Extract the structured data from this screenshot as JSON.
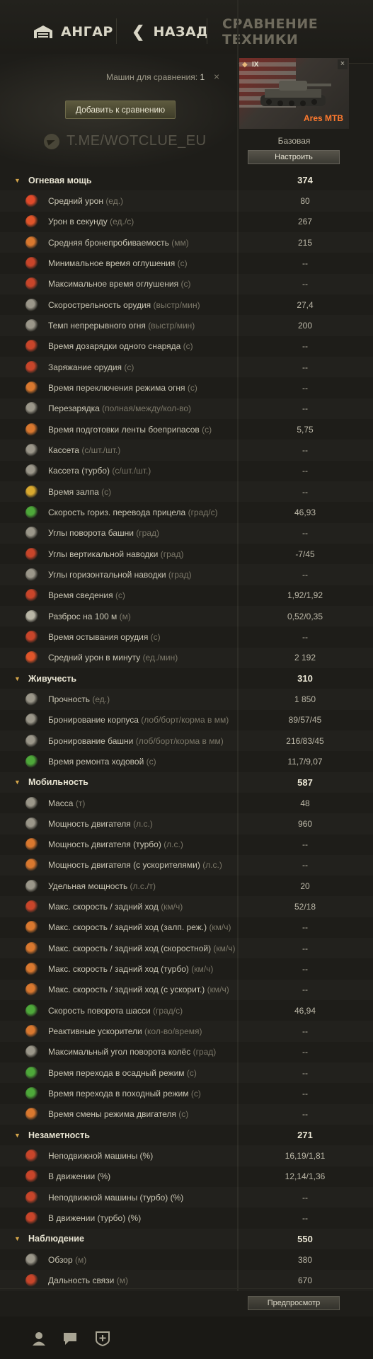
{
  "nav": {
    "hangar_label": "АНГАР",
    "back_label": "НАЗАД",
    "title": "СРАВНЕНИЕ ТЕХНИКИ"
  },
  "compare": {
    "machines_label": "Машин для сравнения:",
    "machines_count": "1",
    "clear_symbol": "×",
    "add_button": "Добавить к сравнению",
    "watermark": "T.ME/WOTCLUE_EU"
  },
  "tank": {
    "tier": "IX",
    "name": "Ares MTB",
    "config": "Базовая",
    "configure_button": "Настроить",
    "close_symbol": "×"
  },
  "rows": [
    {
      "kind": "section",
      "label": "Огневая мощь",
      "value": "374"
    },
    {
      "kind": "stat",
      "label": "Средний урон",
      "unit": "(ед.)",
      "value": "80",
      "icon": "shell-icon",
      "color": "#e04a2a"
    },
    {
      "kind": "stat",
      "label": "Урон в секунду",
      "unit": "(ед./с)",
      "value": "267",
      "icon": "dps-icon",
      "color": "#e0552a"
    },
    {
      "kind": "stat",
      "label": "Средняя бронепробиваемость",
      "unit": "(мм)",
      "value": "215",
      "icon": "penetration-icon",
      "color": "#d9782f"
    },
    {
      "kind": "stat",
      "label": "Минимальное время оглушения",
      "unit": "(с)",
      "value": "--",
      "icon": "stun-min-icon",
      "color": "#c8452a"
    },
    {
      "kind": "stat",
      "label": "Максимальное время оглушения",
      "unit": "(с)",
      "value": "--",
      "icon": "stun-max-icon",
      "color": "#c8452a"
    },
    {
      "kind": "stat",
      "label": "Скорострельность орудия",
      "unit": "(выстр/мин)",
      "value": "27,4",
      "icon": "rate-of-fire-icon",
      "color": "#9b978a"
    },
    {
      "kind": "stat",
      "label": "Темп непрерывного огня",
      "unit": "(выстр/мин)",
      "value": "200",
      "icon": "continuous-fire-icon",
      "color": "#9b978a"
    },
    {
      "kind": "stat",
      "label": "Время дозарядки одного снаряда",
      "unit": "(с)",
      "value": "--",
      "icon": "shell-reload-icon",
      "color": "#c8452a"
    },
    {
      "kind": "stat",
      "label": "Заряжание орудия",
      "unit": "(с)",
      "value": "--",
      "icon": "gun-charge-icon",
      "color": "#c8452a"
    },
    {
      "kind": "stat",
      "label": "Время переключения режима огня",
      "unit": "(с)",
      "value": "--",
      "icon": "fire-mode-icon",
      "color": "#d9782f"
    },
    {
      "kind": "stat",
      "label": "Перезарядка",
      "unit": "(полная/между/кол-во)",
      "value": "--",
      "icon": "reload-icon",
      "color": "#9b978a"
    },
    {
      "kind": "stat",
      "label": "Время подготовки ленты боеприпасов",
      "unit": "(с)",
      "value": "5,75",
      "icon": "ammo-belt-icon",
      "color": "#d9782f"
    },
    {
      "kind": "stat",
      "label": "Кассета",
      "unit": "(с/шт./шт.)",
      "value": "--",
      "icon": "clip-icon",
      "color": "#9b978a"
    },
    {
      "kind": "stat",
      "label": "Кассета (турбо)",
      "unit": "(с/шт./шт.)",
      "value": "--",
      "icon": "clip-turbo-icon",
      "color": "#9b978a"
    },
    {
      "kind": "stat",
      "label": "Время залпа",
      "unit": "(с)",
      "value": "--",
      "icon": "salvo-icon",
      "color": "#d9a92f"
    },
    {
      "kind": "stat",
      "label": "Скорость гориз. перевода прицела",
      "unit": "(град/с)",
      "value": "46,93",
      "icon": "traverse-icon",
      "color": "#4ea83a"
    },
    {
      "kind": "stat",
      "label": "Углы поворота башни",
      "unit": "(град)",
      "value": "--",
      "icon": "turret-angle-icon",
      "color": "#9b978a"
    },
    {
      "kind": "stat",
      "label": "Углы вертикальной наводки",
      "unit": "(град)",
      "value": "-7/45",
      "icon": "elevation-icon",
      "color": "#c8452a"
    },
    {
      "kind": "stat",
      "label": "Углы горизонтальной наводки",
      "unit": "(град)",
      "value": "--",
      "icon": "horizontal-aim-icon",
      "color": "#9b978a"
    },
    {
      "kind": "stat",
      "label": "Время сведения",
      "unit": "(с)",
      "value": "1,92/1,92",
      "icon": "aim-time-icon",
      "color": "#c8452a"
    },
    {
      "kind": "stat",
      "label": "Разброс на 100 м",
      "unit": "(м)",
      "value": "0,52/0,35",
      "icon": "dispersion-icon",
      "color": "#b9b6a6"
    },
    {
      "kind": "stat",
      "label": "Время остывания орудия",
      "unit": "(с)",
      "value": "--",
      "icon": "cooling-icon",
      "color": "#c8452a"
    },
    {
      "kind": "stat",
      "label": "Средний урон в минуту",
      "unit": "(ед./мин)",
      "value": "2 192",
      "icon": "dpm-icon",
      "color": "#e0552a"
    },
    {
      "kind": "section",
      "label": "Живучесть",
      "value": "310"
    },
    {
      "kind": "stat",
      "label": "Прочность",
      "unit": "(ед.)",
      "value": "1 850",
      "icon": "hit-points-icon",
      "color": "#9b978a"
    },
    {
      "kind": "stat",
      "label": "Бронирование корпуса",
      "unit": "(лоб/борт/корма в мм)",
      "value": "89/57/45",
      "icon": "hull-armor-icon",
      "color": "#9b978a"
    },
    {
      "kind": "stat",
      "label": "Бронирование башни",
      "unit": "(лоб/борт/корма в мм)",
      "value": "216/83/45",
      "icon": "turret-armor-icon",
      "color": "#9b978a"
    },
    {
      "kind": "stat",
      "label": "Время ремонта ходовой",
      "unit": "(с)",
      "value": "11,7/9,07",
      "icon": "track-repair-icon",
      "color": "#4ea83a"
    },
    {
      "kind": "section",
      "label": "Мобильность",
      "value": "587"
    },
    {
      "kind": "stat",
      "label": "Масса",
      "unit": "(т)",
      "value": "48",
      "icon": "weight-icon",
      "color": "#9b978a"
    },
    {
      "kind": "stat",
      "label": "Мощность двигателя",
      "unit": "(л.с.)",
      "value": "960",
      "icon": "engine-icon",
      "color": "#9b978a"
    },
    {
      "kind": "stat",
      "label": "Мощность двигателя (турбо)",
      "unit": "(л.с.)",
      "value": "--",
      "icon": "engine-turbo-icon",
      "color": "#d9782f"
    },
    {
      "kind": "stat",
      "label": "Мощность двигателя (с ускорителями)",
      "unit": "(л.с.)",
      "value": "--",
      "icon": "engine-boost-icon",
      "color": "#d9782f"
    },
    {
      "kind": "stat",
      "label": "Удельная мощность",
      "unit": "(л.с./т)",
      "value": "20",
      "icon": "power-ratio-icon",
      "color": "#9b978a"
    },
    {
      "kind": "stat",
      "label": "Макс. скорость / задний ход",
      "unit": "(км/ч)",
      "value": "52/18",
      "icon": "speed-icon",
      "color": "#c8452a"
    },
    {
      "kind": "stat",
      "label": "Макс. скорость / задний ход (залп. реж.)",
      "unit": "(км/ч)",
      "value": "--",
      "icon": "speed-salvo-icon",
      "color": "#d9782f"
    },
    {
      "kind": "stat",
      "label": "Макс. скорость / задний ход (скоростной)",
      "unit": "(км/ч)",
      "value": "--",
      "icon": "speed-fast-icon",
      "color": "#d9782f"
    },
    {
      "kind": "stat",
      "label": "Макс. скорость / задний ход (турбо)",
      "unit": "(км/ч)",
      "value": "--",
      "icon": "speed-turbo-icon",
      "color": "#d9782f"
    },
    {
      "kind": "stat",
      "label": "Макс. скорость / задний ход (с ускорит.)",
      "unit": "(км/ч)",
      "value": "--",
      "icon": "speed-boost-icon",
      "color": "#d9782f"
    },
    {
      "kind": "stat",
      "label": "Скорость поворота шасси",
      "unit": "(град/с)",
      "value": "46,94",
      "icon": "hull-traverse-icon",
      "color": "#4ea83a"
    },
    {
      "kind": "stat",
      "label": "Реактивные ускорители",
      "unit": "(кол-во/время)",
      "value": "--",
      "icon": "rocket-booster-icon",
      "color": "#d9782f"
    },
    {
      "kind": "stat",
      "label": "Максимальный угол поворота колёс",
      "unit": "(град)",
      "value": "--",
      "icon": "wheel-angle-icon",
      "color": "#9b978a"
    },
    {
      "kind": "stat",
      "label": "Время перехода в осадный режим",
      "unit": "(с)",
      "value": "--",
      "icon": "siege-mode-icon",
      "color": "#4ea83a"
    },
    {
      "kind": "stat",
      "label": "Время перехода в походный режим",
      "unit": "(с)",
      "value": "--",
      "icon": "travel-mode-icon",
      "color": "#4ea83a"
    },
    {
      "kind": "stat",
      "label": "Время смены режима двигателя",
      "unit": "(с)",
      "value": "--",
      "icon": "engine-mode-icon",
      "color": "#d9782f"
    },
    {
      "kind": "section",
      "label": "Незаметность",
      "value": "271"
    },
    {
      "kind": "stat",
      "label": "Неподвижной машины (%)",
      "unit": "",
      "value": "16,19/1,81",
      "icon": "camo-still-icon",
      "color": "#c8452a"
    },
    {
      "kind": "stat",
      "label": "В движении (%)",
      "unit": "",
      "value": "12,14/1,36",
      "icon": "camo-moving-icon",
      "color": "#c8452a"
    },
    {
      "kind": "stat",
      "label": "Неподвижной машины (турбо) (%)",
      "unit": "",
      "value": "--",
      "icon": "camo-still-turbo-icon",
      "color": "#c8452a"
    },
    {
      "kind": "stat",
      "label": "В движении (турбо) (%)",
      "unit": "",
      "value": "--",
      "icon": "camo-moving-turbo-icon",
      "color": "#c8452a"
    },
    {
      "kind": "section",
      "label": "Наблюдение",
      "value": "550"
    },
    {
      "kind": "stat",
      "label": "Обзор",
      "unit": "(м)",
      "value": "380",
      "icon": "view-range-icon",
      "color": "#9b978a"
    },
    {
      "kind": "stat",
      "label": "Дальность связи",
      "unit": "(м)",
      "value": "670",
      "icon": "radio-range-icon",
      "color": "#c8452a"
    }
  ],
  "preview_button": "Предпросмотр",
  "bottom_icons": [
    "user-icon",
    "chat-icon",
    "clan-icon"
  ]
}
